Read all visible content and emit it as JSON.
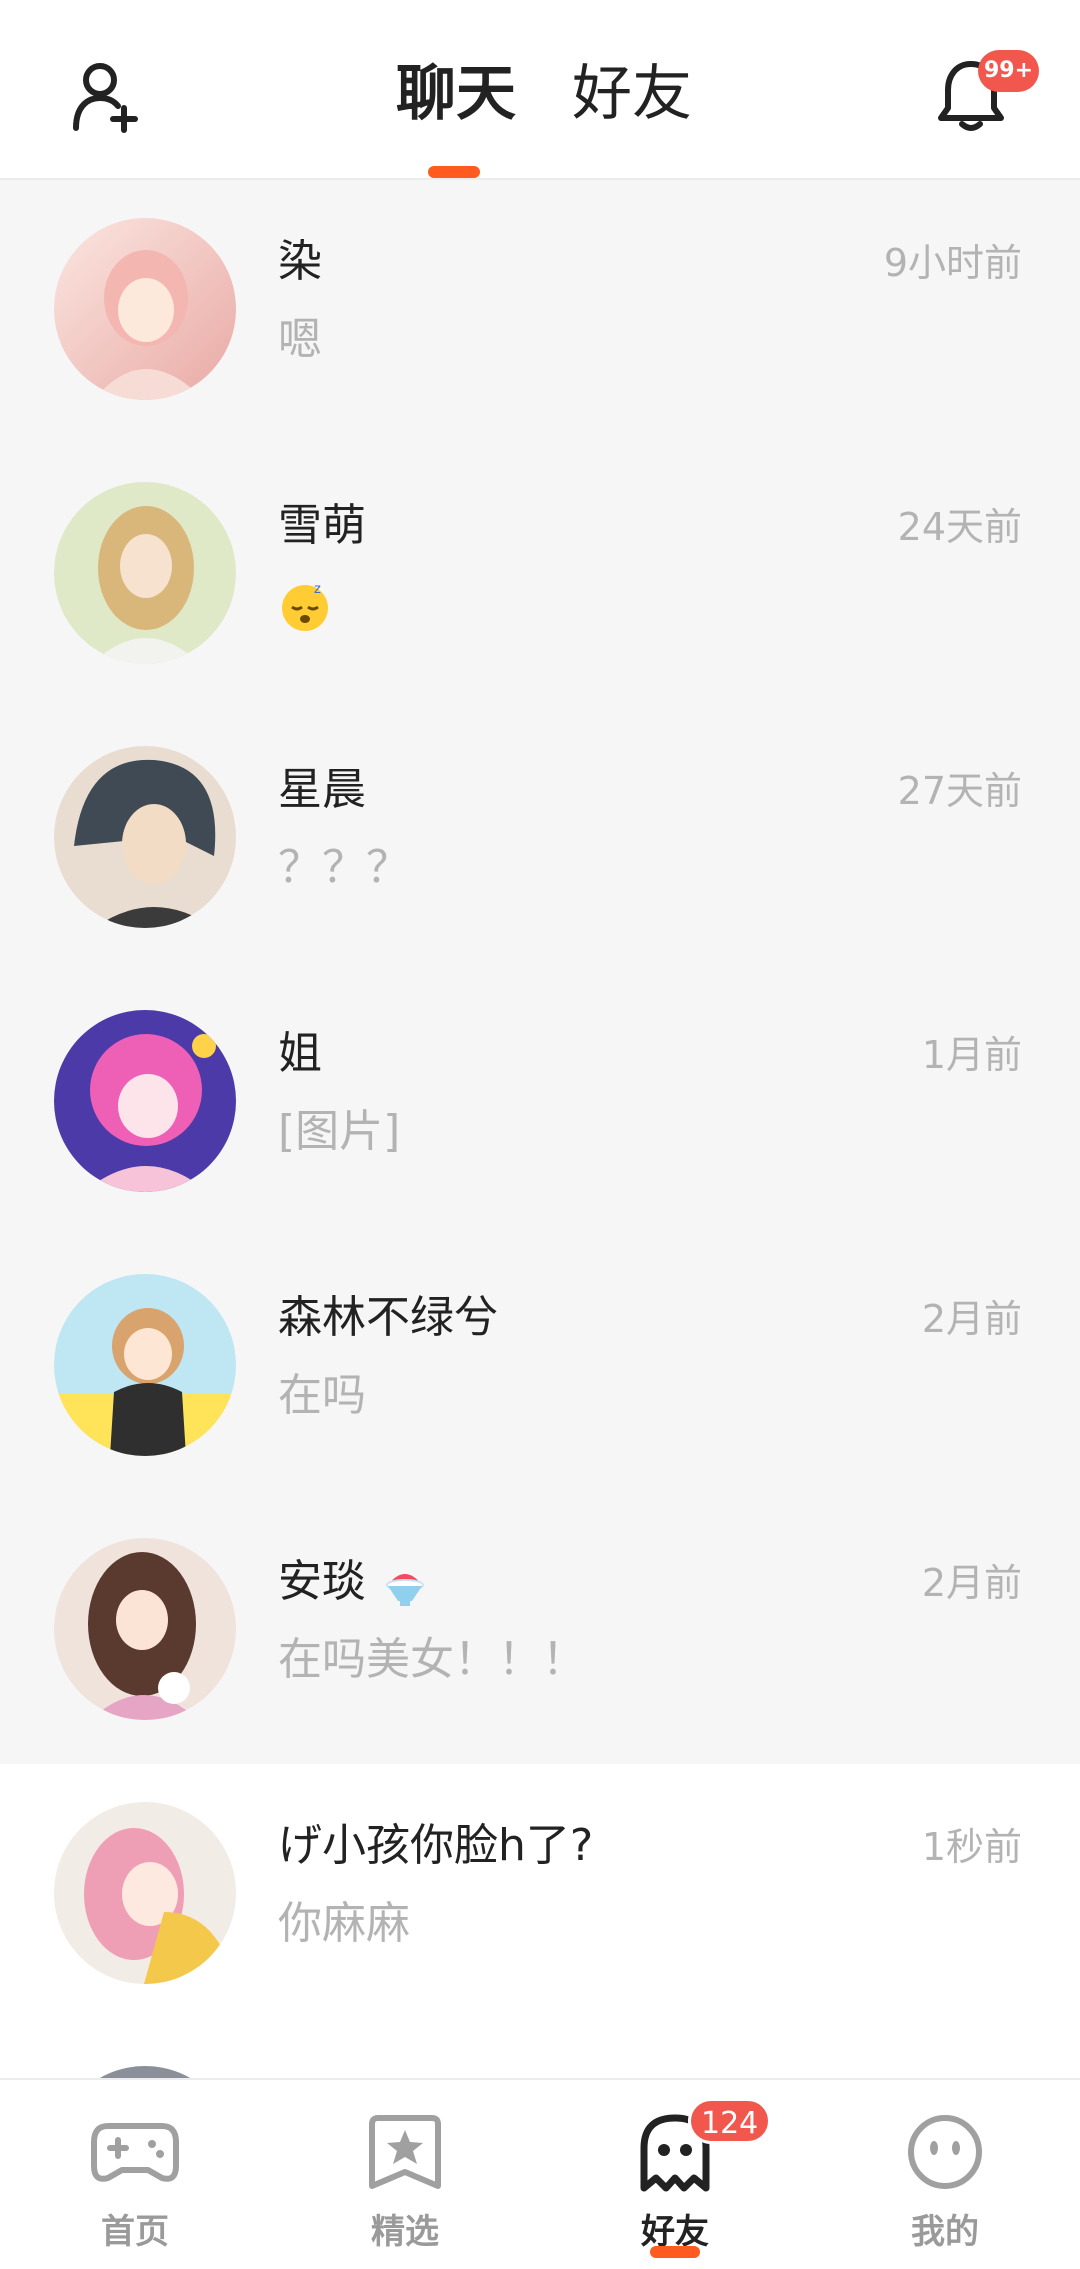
{
  "header": {
    "tabs": [
      {
        "label": "聊天",
        "active": true
      },
      {
        "label": "好友",
        "active": false
      }
    ],
    "notification_badge": "99+",
    "accent_color": "#ff5a1f",
    "badge_color": "#f2574e"
  },
  "chats": [
    {
      "name": "染",
      "preview": "嗯",
      "time": "9小时前"
    },
    {
      "name": "雪萌",
      "preview": "",
      "preview_emoji": "sleepy-face-emoji",
      "time": "24天前"
    },
    {
      "name": "星晨",
      "preview": "？？？",
      "time": "27天前"
    },
    {
      "name": "姐",
      "preview": "[图片]",
      "time": "1月前"
    },
    {
      "name": "森林不绿兮",
      "preview": "在吗",
      "time": "2月前"
    },
    {
      "name": "安琰",
      "name_emoji": "shaved-ice-emoji",
      "preview": "在吗美女！！！",
      "time": "2月前"
    },
    {
      "name": "げ小孩你脸h了?",
      "preview": "你麻麻",
      "time": "1秒前"
    }
  ],
  "bottom_nav": {
    "items": [
      {
        "label": "首页",
        "icon": "gamepad-icon",
        "active": false
      },
      {
        "label": "精选",
        "icon": "star-bookmark-icon",
        "active": false
      },
      {
        "label": "好友",
        "icon": "ghost-icon",
        "active": true,
        "badge": "124"
      },
      {
        "label": "我的",
        "icon": "smiley-face-icon",
        "active": false
      }
    ]
  }
}
